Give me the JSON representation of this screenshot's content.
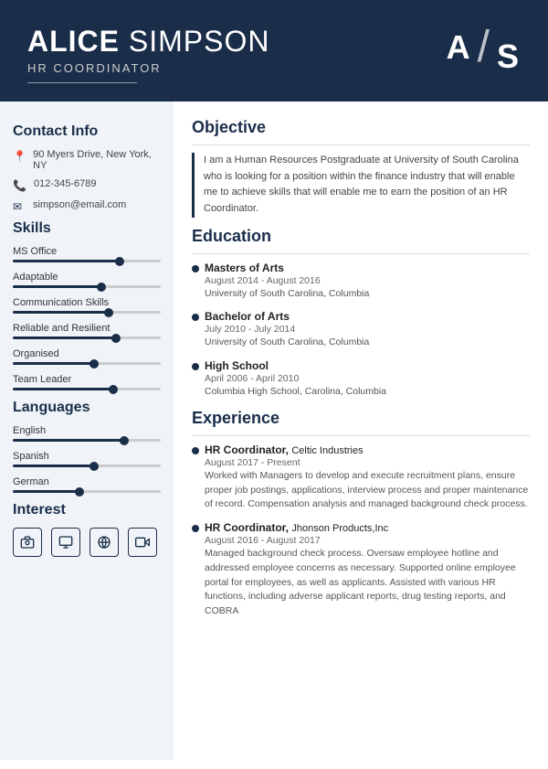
{
  "header": {
    "first_name": "ALICE",
    "last_name": "SIMPSON",
    "title": "HR COORDINATOR",
    "monogram_a": "A",
    "monogram_s": "S"
  },
  "left": {
    "contact_title": "Contact Info",
    "contact": {
      "address": "90 Myers Drive, New York, NY",
      "phone": "012-345-6789",
      "email": "simpson@email.com"
    },
    "skills_title": "Skills",
    "skills": [
      {
        "name": "MS Office",
        "percent": 72
      },
      {
        "name": "Adaptable",
        "percent": 60
      },
      {
        "name": "Communication Skills",
        "percent": 65
      },
      {
        "name": "Reliable and Resilient",
        "percent": 70
      },
      {
        "name": "Organised",
        "percent": 55
      },
      {
        "name": "Team Leader",
        "percent": 68
      }
    ],
    "languages_title": "Languages",
    "languages": [
      {
        "name": "English",
        "percent": 75
      },
      {
        "name": "Spanish",
        "percent": 55
      },
      {
        "name": "German",
        "percent": 45
      }
    ],
    "interest_title": "Interest",
    "interests": [
      "camera",
      "person",
      "globe",
      "video"
    ]
  },
  "right": {
    "objective_title": "Objective",
    "objective_text": "I am a Human Resources Postgraduate at University of South Carolina who is looking for a position within the finance industry that will enable me to achieve skills that will enable me to earn the position of an HR Coordinator.",
    "education_title": "Education",
    "education": [
      {
        "degree": "Masters of Arts",
        "dates": "August 2014 - August 2016",
        "school": "University of South Carolina, Columbia"
      },
      {
        "degree": "Bachelor of Arts",
        "dates": "July 2010 - July 2014",
        "school": "University of South Carolina, Columbia"
      },
      {
        "degree": "High School",
        "dates": "April 2006 - April 2010",
        "school": "Columbia High School, Carolina, Columbia"
      }
    ],
    "experience_title": "Experience",
    "experience": [
      {
        "title": "HR Coordinator",
        "company": "Celtic Industries",
        "dates": "August 2017 - Present",
        "desc": "Worked with Managers to develop and execute recruitment plans, ensure proper job postings, applications, interview process and proper maintenance of record. Compensation analysis and managed background check process."
      },
      {
        "title": "HR Coordinator",
        "company": "Jhonson Products,Inc",
        "dates": "August 2016 - August 2017",
        "desc": "Managed background check process. Oversaw employee hotline and addressed employee concerns as necessary. Supported online employee portal for employees, as well as applicants. Assisted with various HR functions, including adverse applicant reports, drug testing reports, and COBRA"
      }
    ]
  }
}
